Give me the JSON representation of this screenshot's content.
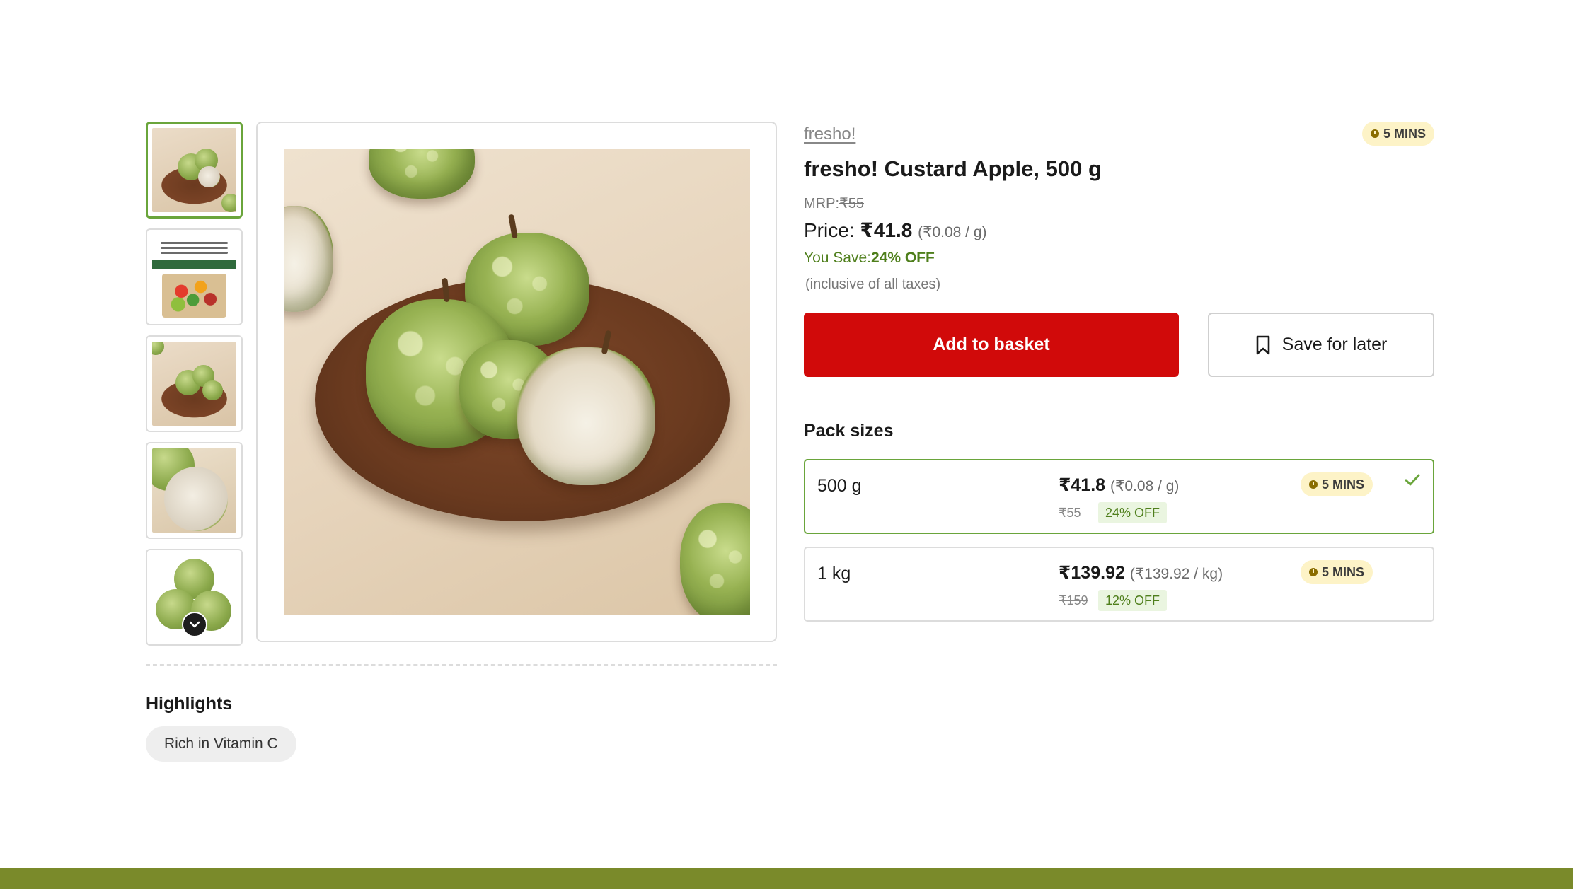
{
  "gallery": {
    "thumbnails": [
      {
        "alt": "custard apples on wooden board",
        "active": true
      },
      {
        "alt": "produce information card",
        "active": false
      },
      {
        "alt": "custard apples on wooden board",
        "active": false
      },
      {
        "alt": "custard apple cut open",
        "active": false
      },
      {
        "alt": "custard apples stacked",
        "active": false
      }
    ],
    "scroll_down_icon": "chevron-down-icon"
  },
  "highlights": {
    "title": "Highlights",
    "chips": [
      "Rich in Vitamin C"
    ]
  },
  "product": {
    "brand": "fresho!",
    "eta": "5 MINS",
    "title": "fresho! Custard Apple, 500 g",
    "mrp_label": "MRP:",
    "mrp_value": "₹55",
    "price_label": "Price: ",
    "price_value": "₹41.8",
    "price_unit": "(₹0.08 / g)",
    "save_label": "You Save:",
    "save_value": "24% OFF",
    "tax_note": "(inclusive of all taxes)"
  },
  "actions": {
    "add_to_basket": "Add to basket",
    "save_for_later": "Save for later"
  },
  "pack_sizes": {
    "title": "Pack sizes",
    "items": [
      {
        "size": "500 g",
        "price": "₹41.8",
        "unit": "(₹0.08 / g)",
        "mrp": "₹55",
        "off": "24% OFF",
        "eta": "5 MINS",
        "selected": true
      },
      {
        "size": "1 kg",
        "price": "₹139.92",
        "unit": "(₹139.92 / kg)",
        "mrp": "₹159",
        "off": "12% OFF",
        "eta": "5 MINS",
        "selected": false
      }
    ]
  },
  "colors": {
    "primary_red": "#d10a0a",
    "accent_green": "#6aa53b",
    "save_green": "#4f7f1c",
    "eta_bg": "#fdf3c7",
    "footer": "#7a8a2a"
  }
}
